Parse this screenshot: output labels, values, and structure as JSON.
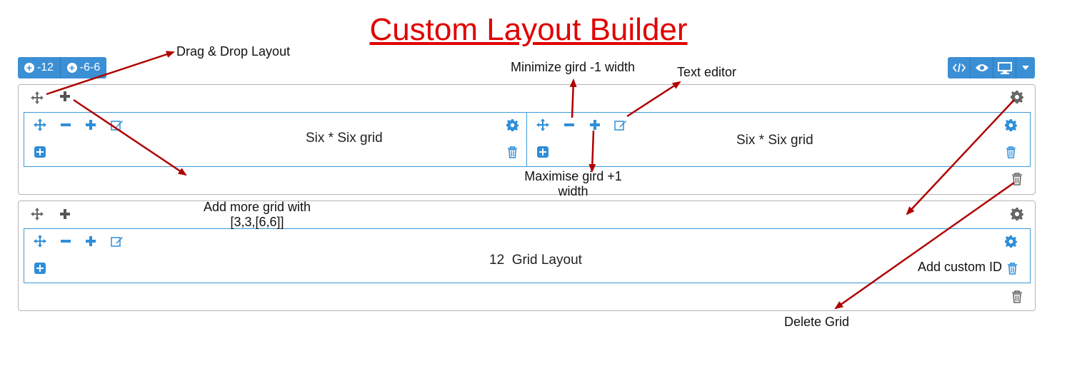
{
  "title": "Custom Layout Builder",
  "toolbar_left": {
    "buttons": [
      {
        "label": "-12",
        "icon": "plus-circle-icon"
      },
      {
        "label": "-6-6",
        "icon": "plus-circle-icon"
      }
    ]
  },
  "toolbar_right": {
    "buttons": [
      {
        "icon": "code-icon"
      },
      {
        "icon": "eye-icon"
      },
      {
        "icon": "desktop-icon"
      },
      {
        "icon": "caret-down-icon"
      }
    ]
  },
  "rows": [
    {
      "columns": [
        {
          "label": "Six * Six grid"
        },
        {
          "label": "Six * Six grid"
        }
      ]
    },
    {
      "columns": [
        {
          "label": "12  Grid Layout"
        }
      ]
    }
  ],
  "annotations": {
    "drag_drop": "Drag & Drop Layout",
    "minimize": "Minimize gird -1 width",
    "text_editor": "Text editor",
    "maximise_line1": "Maximise gird +1",
    "maximise_line2": "width",
    "add_more_line1": "Add more grid with",
    "add_more_line2": "[3,3,[6,6]]",
    "custom_id": "Add custom ID",
    "delete_grid": "Delete Grid"
  },
  "colors": {
    "title": "#e00000",
    "accent": "#3b8fd5",
    "column_border": "#3b9ad9",
    "icon_gray": "#666666",
    "arrow": "#b00000"
  }
}
